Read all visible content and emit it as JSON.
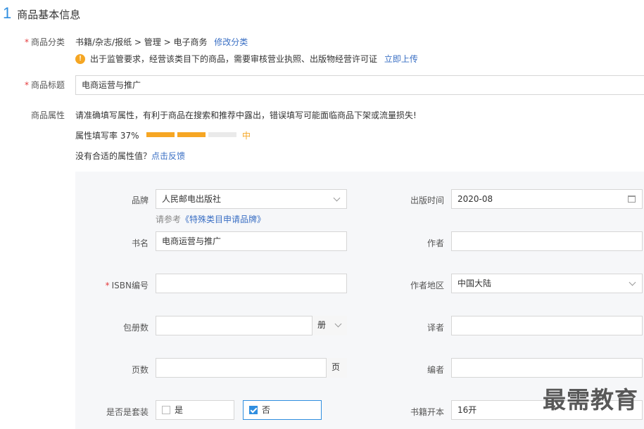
{
  "section": {
    "number": "1",
    "title": "商品基本信息"
  },
  "category": {
    "label": "商品分类",
    "path": "书籍/杂志/报纸 > 管理 > 电子商务",
    "modify_link": "修改分类",
    "warning_text": "出于监管要求，经营该类目下的商品，需要审核营业执照、出版物经营许可证",
    "upload_link": "立即上传"
  },
  "title": {
    "label": "商品标题",
    "value": "电商运营与推广"
  },
  "attributes": {
    "label": "商品属性",
    "hint": "请准确填写属性，有利于商品在搜索和推荐中露出，错误填写可能面临商品下架或流量损失!",
    "fill_rate_label": "属性填写率 37%",
    "fill_level": "中",
    "fill_rate_percent": 37,
    "no_suitable": "没有合适的属性值？",
    "feedback_link": "点击反馈"
  },
  "form": {
    "brand": {
      "label": "品牌",
      "value": "人民邮电出版社",
      "hint_prefix": "请参考",
      "hint_link": "《特殊类目申请品牌》"
    },
    "pub_time": {
      "label": "出版时间",
      "value": "2020-08"
    },
    "book_name": {
      "label": "书名",
      "value": "电商运营与推广"
    },
    "author": {
      "label": "作者",
      "value": ""
    },
    "isbn": {
      "label": "ISBN编号",
      "value": ""
    },
    "author_region": {
      "label": "作者地区",
      "value": "中国大陆"
    },
    "volumes": {
      "label": "包册数",
      "value": "",
      "unit": "册"
    },
    "translator": {
      "label": "译者",
      "value": ""
    },
    "pages": {
      "label": "页数",
      "value": "",
      "unit": "页"
    },
    "editor": {
      "label": "编者",
      "value": ""
    },
    "is_set": {
      "label": "是否是套装",
      "option_yes": "是",
      "option_no": "否",
      "selected": "否"
    },
    "format": {
      "label": "书籍开本",
      "value": "16开"
    }
  },
  "colors": {
    "accent": "#2f8ee0",
    "progress": "#f6a623",
    "required": "#e4393c",
    "link": "#3a6fc4"
  },
  "watermark": "最需教育"
}
